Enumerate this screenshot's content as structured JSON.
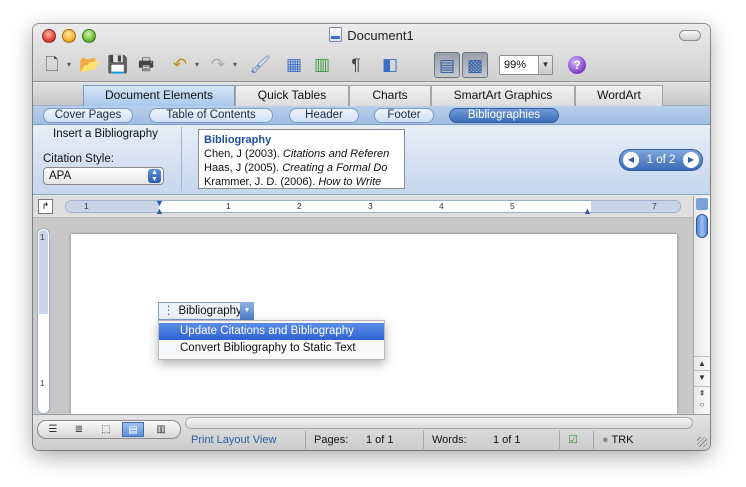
{
  "window": {
    "title": "Document1"
  },
  "toolbar": {
    "zoom": "99%",
    "icons": [
      "new-document-icon",
      "open-icon",
      "save-icon",
      "print-icon",
      "undo-icon",
      "redo-icon",
      "format-painter-icon",
      "table-icon",
      "columns-icon",
      "pilcrow-icon",
      "sidebar-icon",
      "gallery-icon",
      "toolbox-icon",
      "help-icon"
    ]
  },
  "ribbon": {
    "tabs": [
      "Document Elements",
      "Quick Tables",
      "Charts",
      "SmartArt Graphics",
      "WordArt"
    ],
    "active_tab": "Document Elements",
    "subtabs": [
      "Cover Pages",
      "Table of Contents",
      "Header",
      "Footer",
      "Bibliographies"
    ],
    "active_subtab": "Bibliographies",
    "insert_bibliography": "Insert a Bibliography",
    "citation_style_label": "Citation Style:",
    "citation_style_value": "APA",
    "gallery": {
      "title": "Bibliography",
      "entries": [
        {
          "plain": "Chen, J (2003). ",
          "italic": "Citations and Referen"
        },
        {
          "plain": "Haas, J (2005). ",
          "italic": "Creating a Formal Do"
        },
        {
          "plain": "Krammer, J. D. (2006). ",
          "italic": "How to Write"
        }
      ]
    },
    "pager": "1 of 2"
  },
  "ruler": {
    "numbers": [
      "1",
      "1",
      "2",
      "3",
      "4",
      "5",
      "7"
    ]
  },
  "document": {
    "field_label": "Bibliography",
    "menu": [
      {
        "label": "Update Citations and Bibliography",
        "highlighted": true
      },
      {
        "label": "Convert Bibliography to Static Text",
        "highlighted": false
      }
    ]
  },
  "statusbar": {
    "view": "Print Layout View",
    "pages_label": "Pages:",
    "pages_value": "1 of 1",
    "words_label": "Words:",
    "words_value": "1 of 1",
    "track": "TRK"
  },
  "colors": {
    "accent": "#3d6fb8",
    "highlight": "#2f62d1"
  }
}
